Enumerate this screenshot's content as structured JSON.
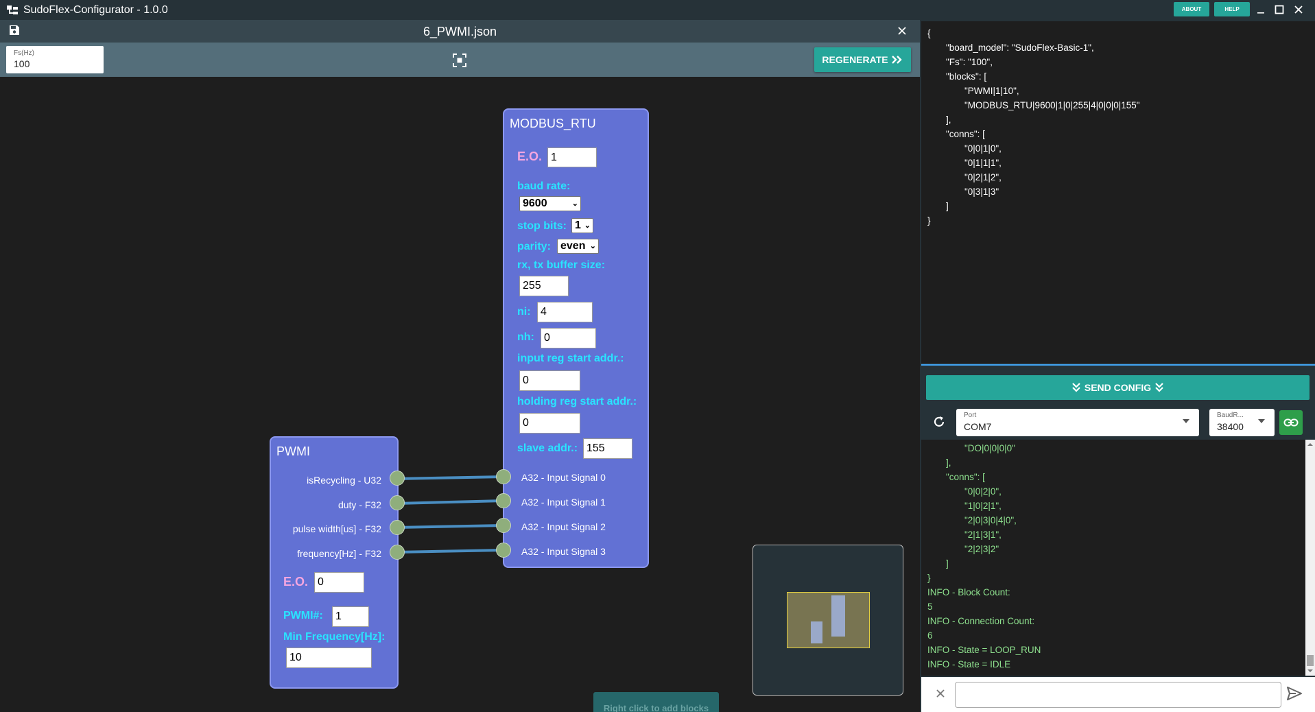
{
  "window": {
    "title": "SudoFlex-Configurator - 1.0.0",
    "about_label": "ABOUT",
    "help_label": "HELP"
  },
  "editor": {
    "file_name": "6_PWMI.json",
    "fs_label": "Fs(Hz)",
    "fs_value": "100",
    "regenerate_label": "REGENERATE",
    "hint": "Right click to add blocks"
  },
  "blocks": {
    "modbus": {
      "title": "MODBUS_RTU",
      "eo_label": "E.O.",
      "eo_value": "1",
      "baud_label": "baud rate:",
      "baud_value": "9600",
      "stop_bits_label": "stop bits:",
      "stop_bits_value": "1",
      "parity_label": "parity:",
      "parity_value": "even",
      "buffer_label": "rx, tx buffer size:",
      "buffer_value": "255",
      "ni_label": "ni:",
      "ni_value": "4",
      "nh_label": "nh:",
      "nh_value": "0",
      "input_reg_label": "input reg start addr.:",
      "input_reg_value": "0",
      "holding_reg_label": "holding reg start addr.:",
      "holding_reg_value": "0",
      "slave_label": "slave addr.:",
      "slave_value": "155",
      "inputs": [
        "A32 - Input Signal 0",
        "A32 - Input Signal 1",
        "A32 - Input Signal 2",
        "A32 - Input Signal 3"
      ]
    },
    "pwmi": {
      "title": "PWMI",
      "outputs": [
        "isRecycling - U32",
        "duty - F32",
        "pulse width[us] - F32",
        "frequency[Hz] - F32"
      ],
      "eo_label": "E.O.",
      "eo_value": "0",
      "pwm_label": "PWMI#:",
      "pwm_value": "1",
      "minfreq_label": "Min Frequency[Hz]:",
      "minfreq_value": "10"
    }
  },
  "json_view": {
    "lines": [
      "{",
      "\"board_model\": \"SudoFlex-Basic-1\",",
      "\"Fs\": \"100\",",
      "\"blocks\": [",
      "\"PWMI|1|10\",",
      "\"MODBUS_RTU|9600|1|0|255|4|0|0|0|155\"",
      "],",
      "\"conns\": [",
      "\"0|0|1|0\",",
      "\"0|1|1|1\",",
      "\"0|2|1|2\",",
      "\"0|3|1|3\"",
      "]",
      "}"
    ]
  },
  "device": {
    "send_label": "SEND CONFIG",
    "port_label": "Port",
    "port_value": "COM7",
    "baud_label": "BaudR...",
    "baud_value": "38400"
  },
  "console": {
    "lines": [
      "\"DO|0|0|0|0\"",
      "],",
      "\"conns\": [",
      "\"0|0|2|0\",",
      "\"1|0|2|1\",",
      "\"2|0|3|0|4|0\",",
      "\"2|1|3|1\",",
      "\"2|2|3|2\"",
      "]",
      "}",
      "INFO - Block Count:",
      "5",
      "INFO - Connection Count:",
      "6",
      "INFO - State = LOOP_RUN",
      "INFO - State = IDLE"
    ]
  }
}
